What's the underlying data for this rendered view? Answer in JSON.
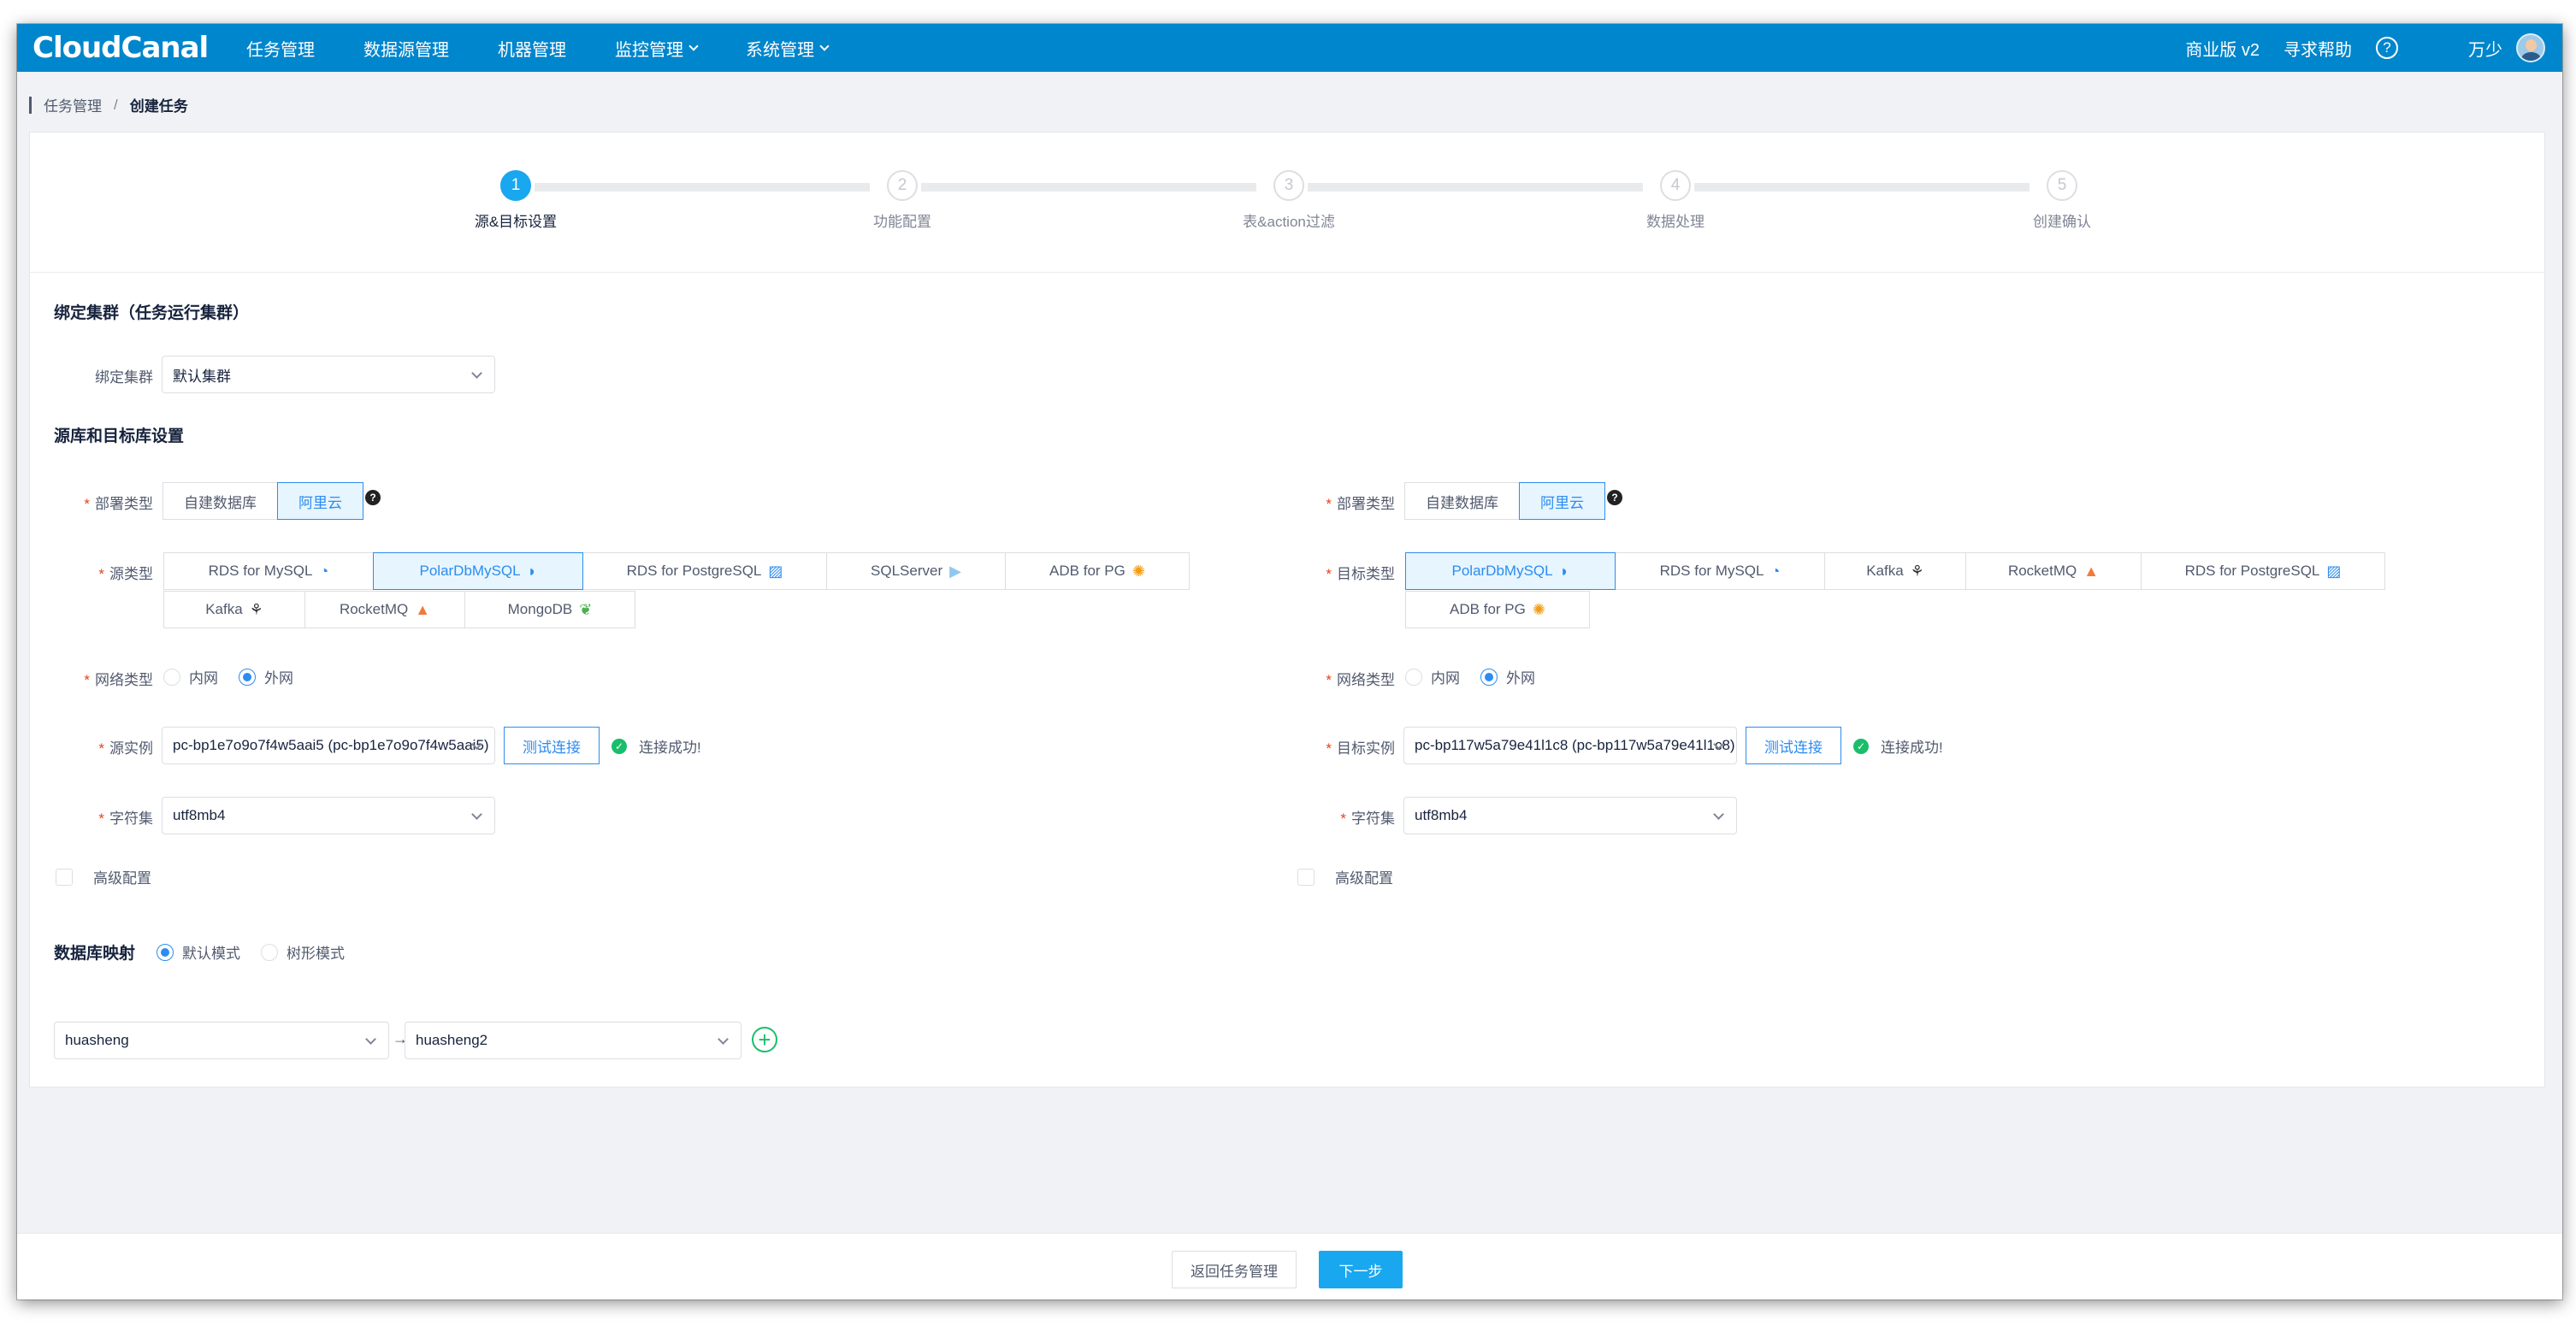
{
  "app": {
    "logo": "CloudCanal"
  },
  "nav": [
    {
      "label": "任务管理"
    },
    {
      "label": "数据源管理"
    },
    {
      "label": "机器管理"
    },
    {
      "label": "监控管理"
    },
    {
      "label": "系统管理"
    }
  ],
  "top_right": {
    "edition": "商业版 v2",
    "help": "寻求帮助",
    "help_icon": "?",
    "user": "万少"
  },
  "breadcrumb": {
    "parent": "任务管理",
    "separator": "/",
    "current": "创建任务"
  },
  "steps": [
    {
      "num": "1",
      "title": "源&目标设置",
      "active": true
    },
    {
      "num": "2",
      "title": "功能配置",
      "active": false
    },
    {
      "num": "3",
      "title": "表&action过滤",
      "active": false
    },
    {
      "num": "4",
      "title": "数据处理",
      "active": false
    },
    {
      "num": "5",
      "title": "创建确认",
      "active": false
    }
  ],
  "cluster": {
    "section_title": "绑定集群（任务运行集群）",
    "label": "绑定集群",
    "value": "默认集群"
  },
  "db_settings": {
    "section_title": "源库和目标库设置"
  },
  "required_mark": "*",
  "source": {
    "deploy_label": "部署类型",
    "deploy_options": [
      "自建数据库",
      "阿里云"
    ],
    "deploy_selected": "阿里云",
    "help_icon": "?",
    "type_label": "源类型",
    "types": [
      {
        "label": "RDS for MySQL",
        "icon": "◔",
        "color": "#2d8cf0"
      },
      {
        "label": "PolarDbMySQL",
        "icon": "◗",
        "color": "#2d8cf0",
        "selected": true
      },
      {
        "label": "RDS for PostgreSQL",
        "icon": "▨",
        "color": "#2d8cf0"
      },
      {
        "label": "SQLServer",
        "icon": "▶",
        "color": "#8fc8ef"
      },
      {
        "label": "ADB for PG",
        "icon": "✺",
        "color": "#f39c12"
      },
      {
        "label": "Kafka",
        "icon": "⚘",
        "color": "#333333"
      },
      {
        "label": "RocketMQ",
        "icon": "▲",
        "color": "#f07b39"
      },
      {
        "label": "MongoDB",
        "icon": "❦",
        "color": "#4caf50"
      }
    ],
    "network_label": "网络类型",
    "network_options": [
      "内网",
      "外网"
    ],
    "network_selected": "外网",
    "instance_label": "源实例",
    "instance_value": "pc-bp1e7o9o7f4w5aai5 (pc-bp1e7o9o7f4w5aai5)",
    "test_button": "测试连接",
    "connect_status": "连接成功!",
    "ok_icon": "✓",
    "charset_label": "字符集",
    "charset_value": "utf8mb4",
    "advanced_label": "高级配置"
  },
  "target": {
    "deploy_label": "部署类型",
    "deploy_options": [
      "自建数据库",
      "阿里云"
    ],
    "deploy_selected": "阿里云",
    "help_icon": "?",
    "type_label": "目标类型",
    "types": [
      {
        "label": "PolarDbMySQL",
        "icon": "◗",
        "color": "#2d8cf0",
        "selected": true
      },
      {
        "label": "RDS for MySQL",
        "icon": "◔",
        "color": "#2d8cf0"
      },
      {
        "label": "Kafka",
        "icon": "⚘",
        "color": "#333333"
      },
      {
        "label": "RocketMQ",
        "icon": "▲",
        "color": "#f07b39"
      },
      {
        "label": "RDS for PostgreSQL",
        "icon": "▨",
        "color": "#2d8cf0"
      },
      {
        "label": "ADB for PG",
        "icon": "✺",
        "color": "#f39c12"
      }
    ],
    "network_label": "网络类型",
    "network_options": [
      "内网",
      "外网"
    ],
    "network_selected": "外网",
    "instance_label": "目标实例",
    "instance_value": "pc-bp117w5a79e41l1c8 (pc-bp117w5a79e41l1c8)",
    "test_button": "测试连接",
    "connect_status": "连接成功!",
    "ok_icon": "✓",
    "charset_label": "字符集",
    "charset_value": "utf8mb4",
    "advanced_label": "高级配置"
  },
  "mapping": {
    "label": "数据库映射",
    "modes": [
      "默认模式",
      "树形模式"
    ],
    "mode_selected": "默认模式",
    "source_db": "huasheng",
    "arrow": "→",
    "target_db": "huasheng2",
    "add_icon": "+"
  },
  "footer": {
    "back_button": "返回任务管理",
    "next_button": "下一步"
  }
}
